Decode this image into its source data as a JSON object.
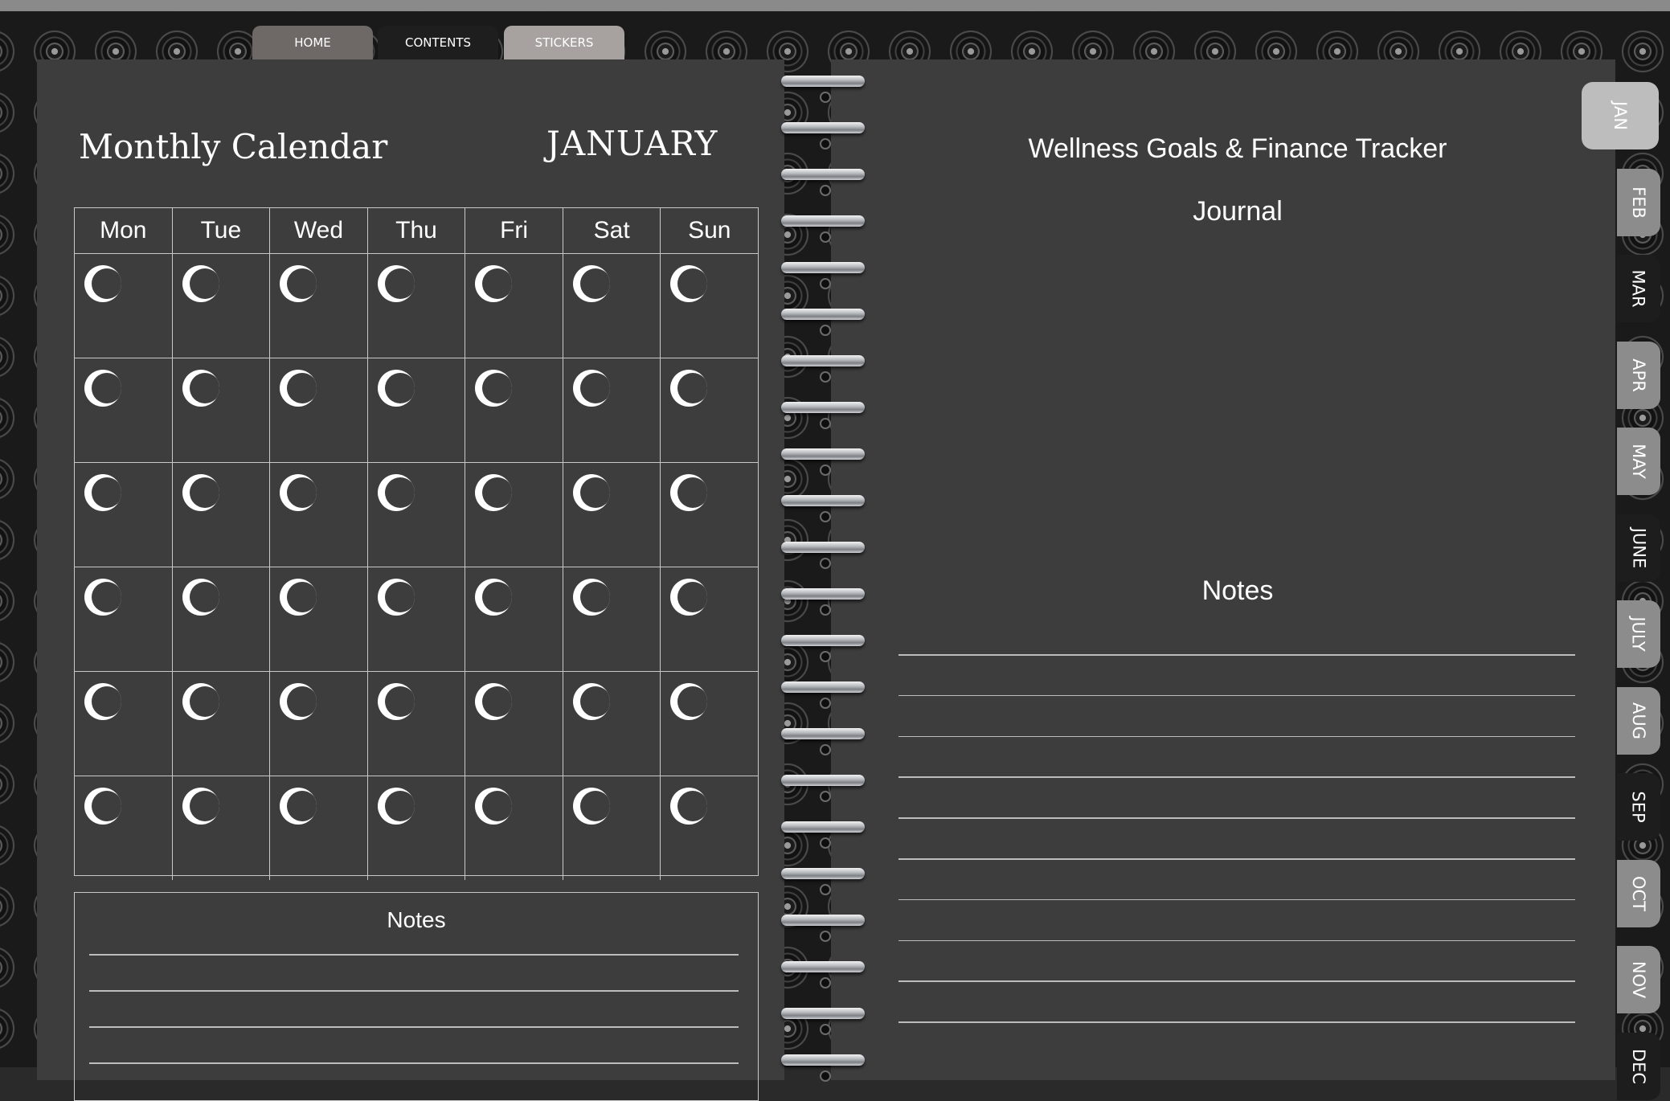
{
  "nav": {
    "home": "HOME",
    "contents": "CONTENTS",
    "stickers": "STICKERS"
  },
  "left_page": {
    "title": "Monthly Calendar",
    "month": "JANUARY",
    "weekdays": [
      "Mon",
      "Tue",
      "Wed",
      "Thu",
      "Fri",
      "Sat",
      "Sun"
    ],
    "notes_label": "Notes"
  },
  "right_page": {
    "title": "Wellness Goals & Finance Tracker",
    "journal_label": "Journal",
    "notes_label": "Notes"
  },
  "month_tabs": [
    "JAN",
    "FEB",
    "MAR",
    "APR",
    "MAY",
    "JUNE",
    "JULY",
    "AUG",
    "SEP",
    "OCT",
    "NOV",
    "DEC"
  ],
  "active_month": "JAN"
}
